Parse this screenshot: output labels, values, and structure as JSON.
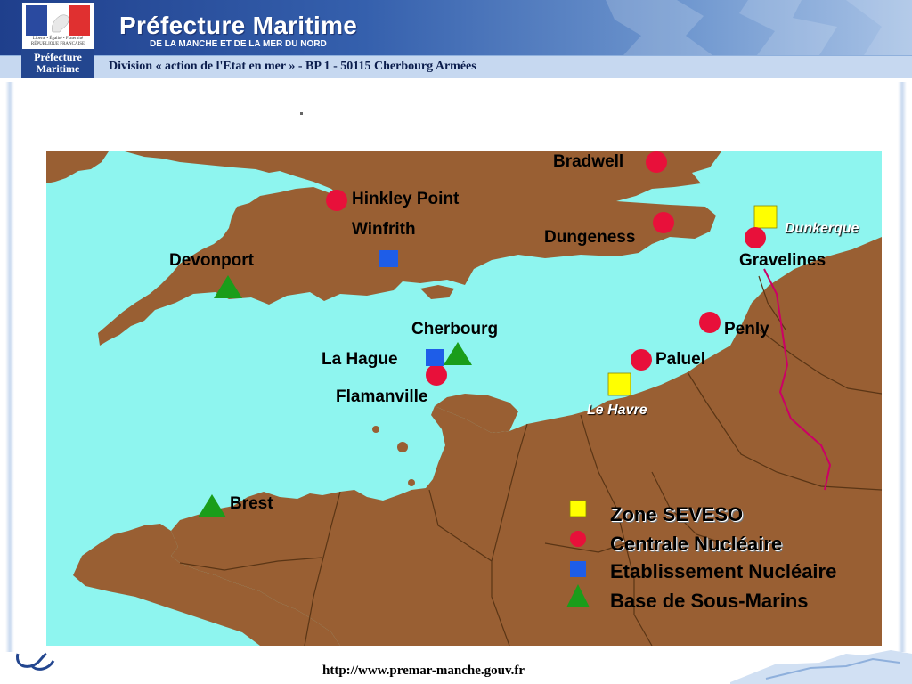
{
  "header": {
    "logo_small_text": "Liberté • Égalité • Fraternité RÉPUBLIQUE FRANÇAISE",
    "logo_name": "Préfecture Maritime",
    "title": "Préfecture Maritime",
    "subtitle": "DE LA MANCHE ET DE LA MER DU NORD",
    "division": "Division « action de l'Etat en mer » - BP 1 - 50115 Cherbourg Armées"
  },
  "map": {
    "colors": {
      "sea": "#8ef5ef",
      "land": "#995f33",
      "border": "#5a3515",
      "seveso": "#ffff00",
      "centrale": "#e8103a",
      "etablissement": "#1e5de8",
      "base": "#1a9d1a"
    },
    "places": [
      {
        "name": "Bradwell",
        "type": "centrale"
      },
      {
        "name": "Hinkley Point",
        "type": "centrale"
      },
      {
        "name": "Winfrith",
        "type": "etablissement"
      },
      {
        "name": "Dungeness",
        "type": "centrale"
      },
      {
        "name": "Devonport",
        "type": "base"
      },
      {
        "name": "Gravelines",
        "type": "centrale"
      },
      {
        "name": "Cherbourg",
        "type": "base"
      },
      {
        "name": "Penly",
        "type": "centrale"
      },
      {
        "name": "La Hague",
        "type": "etablissement"
      },
      {
        "name": "Paluel",
        "type": "centrale"
      },
      {
        "name": "Flamanville",
        "type": "centrale"
      },
      {
        "name": "Brest",
        "type": "base"
      }
    ],
    "ports": [
      {
        "name": "Dunkerque",
        "type": "seveso"
      },
      {
        "name": "Le Havre",
        "type": "seveso"
      }
    ],
    "legend": [
      {
        "label": "Zone SEVESO",
        "symbol": "yellow-square"
      },
      {
        "label": "Centrale Nucléaire",
        "symbol": "red-circle"
      },
      {
        "label": "Etablissement Nucléaire",
        "symbol": "blue-square"
      },
      {
        "label": "Base de Sous-Marins",
        "symbol": "green-triangle"
      }
    ]
  },
  "footer": {
    "url": "http://www.premar-manche.gouv.fr"
  }
}
